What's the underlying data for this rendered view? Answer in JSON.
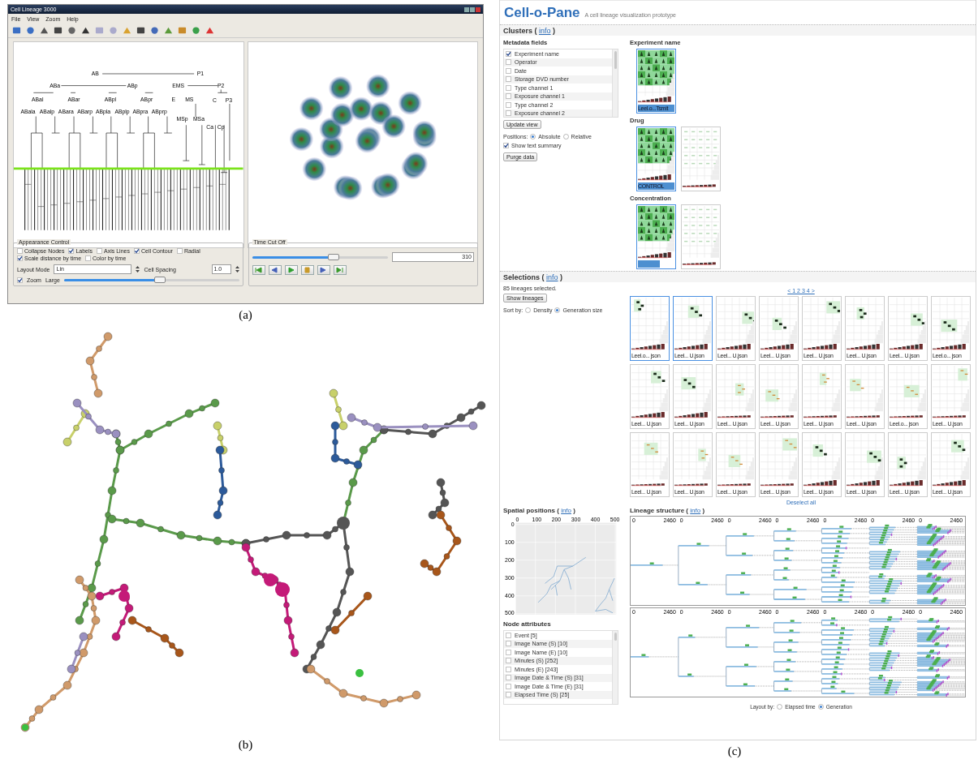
{
  "panel_a": {
    "caption": "(a)",
    "window": {
      "title": "Cell Lineage 3000"
    },
    "menu": [
      "File",
      "View",
      "Zoom",
      "Help"
    ],
    "tree_labels": [
      "AB",
      "P1",
      "ABa",
      "ABp",
      "EMS",
      "P2",
      "ABal",
      "ABar",
      "ABpl",
      "ABpr",
      "E",
      "MS",
      "C",
      "P3",
      "ABala",
      "ABalp",
      "ABara",
      "ABarp",
      "ABpla",
      "ABplp",
      "ABpra",
      "ABprp",
      "MSp",
      "MSa",
      "Ca",
      "Cp"
    ],
    "appearance": {
      "title": "Appearance Control",
      "options": [
        {
          "label": "Collapse Nodes",
          "checked": false
        },
        {
          "label": "Labels",
          "checked": true
        },
        {
          "label": "Axis Lines",
          "checked": false
        },
        {
          "label": "Cell Contour",
          "checked": true
        },
        {
          "label": "Radial",
          "checked": false
        },
        {
          "label": "Scale distance by time",
          "checked": true
        },
        {
          "label": "Color by time",
          "checked": false
        }
      ],
      "layout_mode": {
        "label": "Layout Mode",
        "value": "Lin"
      },
      "cell_spacing": {
        "label": "Cell Spacing",
        "value": "1.0"
      },
      "zoom": {
        "label": "Zoom",
        "checked": true,
        "size": "Large",
        "level": 0.55
      }
    },
    "time_cut_off": {
      "title": "Time Cut Off",
      "level": 0.6,
      "value": "310"
    }
  },
  "panel_b": {
    "caption": "(b)"
  },
  "panel_c": {
    "caption": "(c)",
    "title": "Cell-o-Pane",
    "subtitle": "A cell lineage visualization prototype",
    "clusters": {
      "heading_before": "Clusters (",
      "link": "info",
      "heading_after": ")",
      "metadata_fields": {
        "heading": "Metadata fields",
        "items": [
          {
            "label": "Experiment name",
            "checked": true
          },
          {
            "label": "Operator",
            "checked": false
          },
          {
            "label": "Date",
            "checked": false
          },
          {
            "label": "Storage DVD number",
            "checked": false
          },
          {
            "label": "Type channel 1",
            "checked": false
          },
          {
            "label": "Exposure channel 1",
            "checked": false
          },
          {
            "label": "Type channel 2",
            "checked": false
          },
          {
            "label": "Exposure channel 2",
            "checked": false
          }
        ]
      },
      "update_button": "Update view",
      "positions": {
        "label": "Positions:",
        "options": [
          {
            "label": "Absolute",
            "selected": true
          },
          {
            "label": "Relative",
            "selected": false
          }
        ]
      },
      "show_text_summary": {
        "label": "Show text summary",
        "checked": true
      },
      "purge_button": "Purge data",
      "groups": [
        {
          "title": "Experiment name",
          "cards": [
            {
              "label": "Leel.o...Tsmit",
              "selected": true,
              "kind": "dense"
            }
          ]
        },
        {
          "title": "Drug",
          "cards": [
            {
              "label": "CONTROL",
              "selected": true,
              "kind": "dense"
            },
            {
              "selected": false,
              "kind": "faint"
            }
          ]
        },
        {
          "title": "Concentration",
          "cards": [
            {
              "selected": true,
              "kind": "dense"
            },
            {
              "selected": false,
              "kind": "faint"
            }
          ]
        }
      ]
    },
    "selections": {
      "heading_before": "Selections (",
      "link": "info",
      "heading_after": ")",
      "count": "85 lineages selected.",
      "show_button": "Show lineages",
      "sort": {
        "label": "Sort by:",
        "options": [
          {
            "label": "Density",
            "selected": false
          },
          {
            "label": "Generation size",
            "selected": true
          }
        ]
      },
      "pager": "< 1 2 3 4 >",
      "thumbnails": [
        {
          "label": "Leel.o... json",
          "selected": true
        },
        {
          "label": "Leel... U.json",
          "selected": true
        },
        {
          "label": "Leel... U.json",
          "selected": false
        },
        {
          "label": "Leel... U.json",
          "selected": false
        },
        {
          "label": "Leel... U.json",
          "selected": false
        },
        {
          "label": "Leel... U.json",
          "selected": false
        },
        {
          "label": "Leel... U.json",
          "selected": false
        },
        {
          "label": "Leel.o... json",
          "selected": false
        },
        {
          "label": "Leel... U.json",
          "selected": false
        },
        {
          "label": "Leel... U.json",
          "selected": false
        },
        {
          "label": "Leel... U.json",
          "selected": false
        },
        {
          "label": "Leel... U.json",
          "selected": false
        },
        {
          "label": "Leel... U.json",
          "selected": false
        },
        {
          "label": "Leel... U.json",
          "selected": false
        },
        {
          "label": "Leel.o... json",
          "selected": false
        },
        {
          "label": "Leel... U.json",
          "selected": false
        },
        {
          "label": "Leel... U.json",
          "selected": false
        },
        {
          "label": "Leel... U.json",
          "selected": false
        },
        {
          "label": "Leel... U.json",
          "selected": false
        },
        {
          "label": "Leel... U.json",
          "selected": false
        },
        {
          "label": "Leel... U.json",
          "selected": false
        },
        {
          "label": "Leel... U.json",
          "selected": false
        },
        {
          "label": "Leel... U.json",
          "selected": false
        },
        {
          "label": "Leel... U.json",
          "selected": false
        }
      ],
      "deselect": "Deselect all"
    },
    "spatial": {
      "heading_before": "Spatial positions (",
      "link": "info",
      "heading_after": ")",
      "x_ticks": [
        "0",
        "100",
        "200",
        "300",
        "400",
        "500"
      ],
      "y_ticks": [
        "0",
        "100",
        "200",
        "300",
        "400",
        "500"
      ]
    },
    "node_attributes": {
      "heading": "Node attributes",
      "items": [
        {
          "label": "Event [5]",
          "checked": false
        },
        {
          "label": "Image Name (S) [10]",
          "checked": false
        },
        {
          "label": "Image Name (E) [10]",
          "checked": false
        },
        {
          "label": "Minutes (S) [252]",
          "checked": false
        },
        {
          "label": "Minutes (E) [243]",
          "checked": false
        },
        {
          "label": "Image Date & Time (S) [31]",
          "checked": false
        },
        {
          "label": "Image Date & Time (E) [31]",
          "checked": false
        },
        {
          "label": "Elapsed Time (S) [25]",
          "checked": false
        }
      ]
    },
    "lineage": {
      "heading_before": "Lineage structure (",
      "link": "info",
      "heading_after": ")",
      "trees": [
        {
          "ticks": [
            "0",
            "2460",
            "0",
            "2460",
            "0",
            "2460",
            "0",
            "2460",
            "0",
            "2460",
            "0",
            "2460",
            "0",
            "2460"
          ]
        },
        {
          "ticks": [
            "0",
            "2460",
            "0",
            "2460",
            "0",
            "2460",
            "0",
            "2460",
            "0",
            "2460",
            "0",
            "2460",
            "0",
            "2460"
          ]
        }
      ]
    },
    "layout_by": {
      "label": "Layout by:",
      "options": [
        {
          "label": "Elapsed time",
          "selected": false
        },
        {
          "label": "Generation",
          "selected": true
        }
      ]
    }
  }
}
